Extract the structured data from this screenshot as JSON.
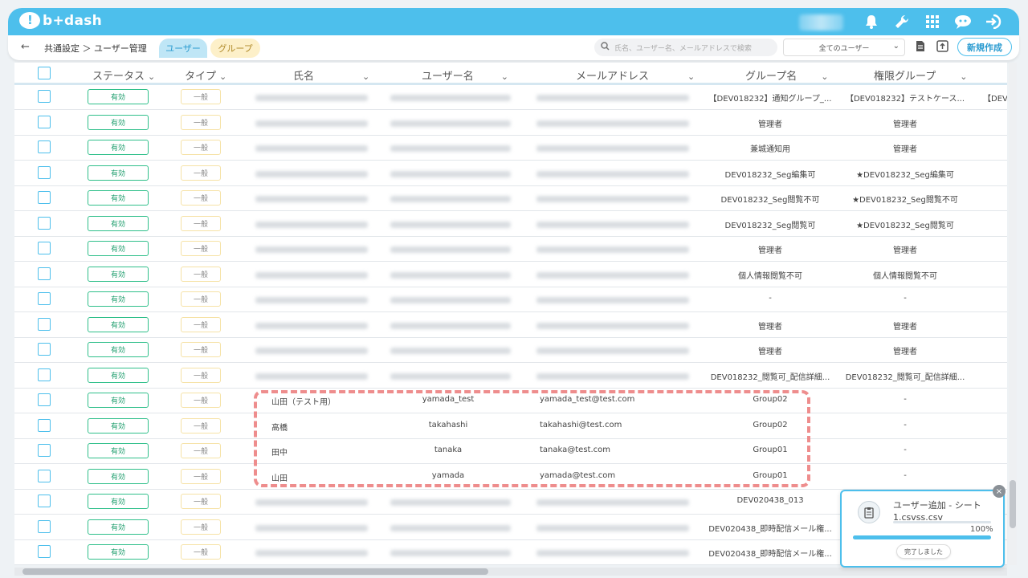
{
  "header": {
    "logo": "b+dash",
    "icons": [
      "bell-icon",
      "wrench-icon",
      "grid-icon",
      "chat-bot-icon",
      "logout-icon"
    ]
  },
  "subbar": {
    "back": "←",
    "breadcrumb": "共通設定 ＞ ユーザー管理",
    "tabs": [
      {
        "label": "ユーザー"
      },
      {
        "label": "グループ"
      }
    ],
    "search_placeholder": "氏名、ユーザー名、メールアドレスで検索",
    "filter": "全てのユーザー",
    "new_button": "新規作成"
  },
  "table": {
    "columns": [
      "ステータス",
      "タイプ",
      "氏名",
      "ユーザー名",
      "メールアドレス",
      "グループ名",
      "権限グループ"
    ],
    "rows": [
      {
        "status": "有効",
        "type": "一般",
        "name": "",
        "username": "",
        "email": "",
        "group": "【DEV018232】通知グループ_...",
        "perm": "【DEV018232】テストケース...",
        "extra": "【DEV"
      },
      {
        "status": "有効",
        "type": "一般",
        "name": "",
        "username": "",
        "email": "",
        "group": "管理者",
        "perm": "管理者",
        "extra": ""
      },
      {
        "status": "有効",
        "type": "一般",
        "name": "",
        "username": "",
        "email": "",
        "group": "兼城通知用",
        "perm": "管理者",
        "extra": ""
      },
      {
        "status": "有効",
        "type": "一般",
        "name": "",
        "username": "",
        "email": "",
        "group": "DEV018232_Seg編集可",
        "perm": "★DEV018232_Seg編集可",
        "extra": ""
      },
      {
        "status": "有効",
        "type": "一般",
        "name": "",
        "username": "",
        "email": "",
        "group": "DEV018232_Seg閲覧不可",
        "perm": "★DEV018232_Seg閲覧不可",
        "extra": ""
      },
      {
        "status": "有効",
        "type": "一般",
        "name": "",
        "username": "",
        "email": "",
        "group": "DEV018232_Seg閲覧可",
        "perm": "★DEV018232_Seg閲覧可",
        "extra": ""
      },
      {
        "status": "有効",
        "type": "一般",
        "name": "",
        "username": "",
        "email": "",
        "group": "管理者",
        "perm": "管理者",
        "extra": ""
      },
      {
        "status": "有効",
        "type": "一般",
        "name": "",
        "username": "",
        "email": "",
        "group": "個人情報閲覧不可",
        "perm": "個人情報閲覧不可",
        "extra": ""
      },
      {
        "status": "有効",
        "type": "一般",
        "name": "",
        "username": "",
        "email": "",
        "group": "-",
        "perm": "-",
        "extra": ""
      },
      {
        "status": "有効",
        "type": "一般",
        "name": "",
        "username": "",
        "email": "",
        "group": "管理者",
        "perm": "管理者",
        "extra": ""
      },
      {
        "status": "有効",
        "type": "一般",
        "name": "",
        "username": "",
        "email": "",
        "group": "管理者",
        "perm": "管理者",
        "extra": ""
      },
      {
        "status": "有効",
        "type": "一般",
        "name": "",
        "username": "",
        "email": "",
        "group": "DEV018232_閲覧可_配信詳細...",
        "perm": "DEV018232_閲覧可_配信詳細...",
        "extra": ""
      },
      {
        "status": "有効",
        "type": "一般",
        "name": "山田（テスト用）",
        "username": "yamada_test",
        "email": "yamada_test@test.com",
        "group": "Group02",
        "perm": "-",
        "extra": ""
      },
      {
        "status": "有効",
        "type": "一般",
        "name": "高橋",
        "username": "takahashi",
        "email": "takahashi@test.com",
        "group": "Group02",
        "perm": "-",
        "extra": ""
      },
      {
        "status": "有効",
        "type": "一般",
        "name": "田中",
        "username": "tanaka",
        "email": "tanaka@test.com",
        "group": "Group01",
        "perm": "-",
        "extra": ""
      },
      {
        "status": "有効",
        "type": "一般",
        "name": "山田",
        "username": "yamada",
        "email": "yamada@test.com",
        "group": "Group01",
        "perm": "-",
        "extra": ""
      },
      {
        "status": "有効",
        "type": "一般",
        "name": "",
        "username": "",
        "email": "",
        "group": "DEV020438_013",
        "perm": "",
        "extra": ""
      },
      {
        "status": "有効",
        "type": "一般",
        "name": "",
        "username": "",
        "email": "",
        "group": "DEV020438_即時配信メール権...",
        "perm": "",
        "extra": ""
      },
      {
        "status": "有効",
        "type": "一般",
        "name": "",
        "username": "",
        "email": "",
        "group": "DEV020438_即時配信メール権...",
        "perm": "",
        "extra": ""
      }
    ]
  },
  "toast": {
    "title": "ユーザー追加 - シート",
    "file": "1.csvss.csv",
    "percent": "100%",
    "progress": 1.0,
    "button": "完了しました",
    "close": "×"
  },
  "colors": {
    "accent": "#4dbfec",
    "status": "#2fbf8a",
    "highlight": "#ee8d8d"
  }
}
